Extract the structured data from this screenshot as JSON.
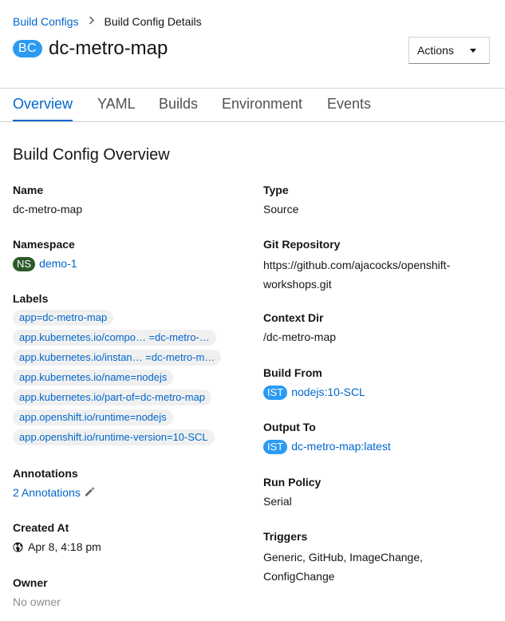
{
  "breadcrumb": {
    "parent": "Build Configs",
    "current": "Build Config Details"
  },
  "header": {
    "badge": "BC",
    "title": "dc-metro-map",
    "actions_label": "Actions"
  },
  "tabs": [
    "Overview",
    "YAML",
    "Builds",
    "Environment",
    "Events"
  ],
  "overview": {
    "section_title": "Build Config Overview",
    "left": {
      "name_label": "Name",
      "name_value": "dc-metro-map",
      "namespace_label": "Namespace",
      "namespace_badge": "NS",
      "namespace_value": "demo-1",
      "labels_label": "Labels",
      "labels": [
        "app=dc-metro-map",
        "app.kubernetes.io/compo… =dc-metro-…",
        "app.kubernetes.io/instan… =dc-metro-m…",
        "app.kubernetes.io/name=nodejs",
        "app.kubernetes.io/part-of=dc-metro-map",
        "app.openshift.io/runtime=nodejs",
        "app.openshift.io/runtime-version=10-SCL"
      ],
      "annotations_label": "Annotations",
      "annotations_value": "2 Annotations",
      "created_label": "Created At",
      "created_value": "Apr 8, 4:18 pm",
      "owner_label": "Owner",
      "owner_value": "No owner"
    },
    "right": {
      "type_label": "Type",
      "type_value": "Source",
      "git_label": "Git Repository",
      "git_value_line1": "https://github.com/ajacocks/openshift-",
      "git_value_line2": "workshops.git",
      "context_label": "Context Dir",
      "context_value": "/dc-metro-map",
      "build_from_label": "Build From",
      "build_from_badge": "IST",
      "build_from_value": "nodejs:10-SCL",
      "output_label": "Output To",
      "output_badge": "IST",
      "output_value": "dc-metro-map:latest",
      "run_policy_label": "Run Policy",
      "run_policy_value": "Serial",
      "triggers_label": "Triggers",
      "triggers_line1": "Generic, GitHub, ImageChange,",
      "triggers_line2": "ConfigChange"
    }
  },
  "colors": {
    "link": "#0066cc",
    "bc_badge": "#2b9af3",
    "ns_badge": "#2d5a2a",
    "ist_badge": "#2b9af3"
  }
}
